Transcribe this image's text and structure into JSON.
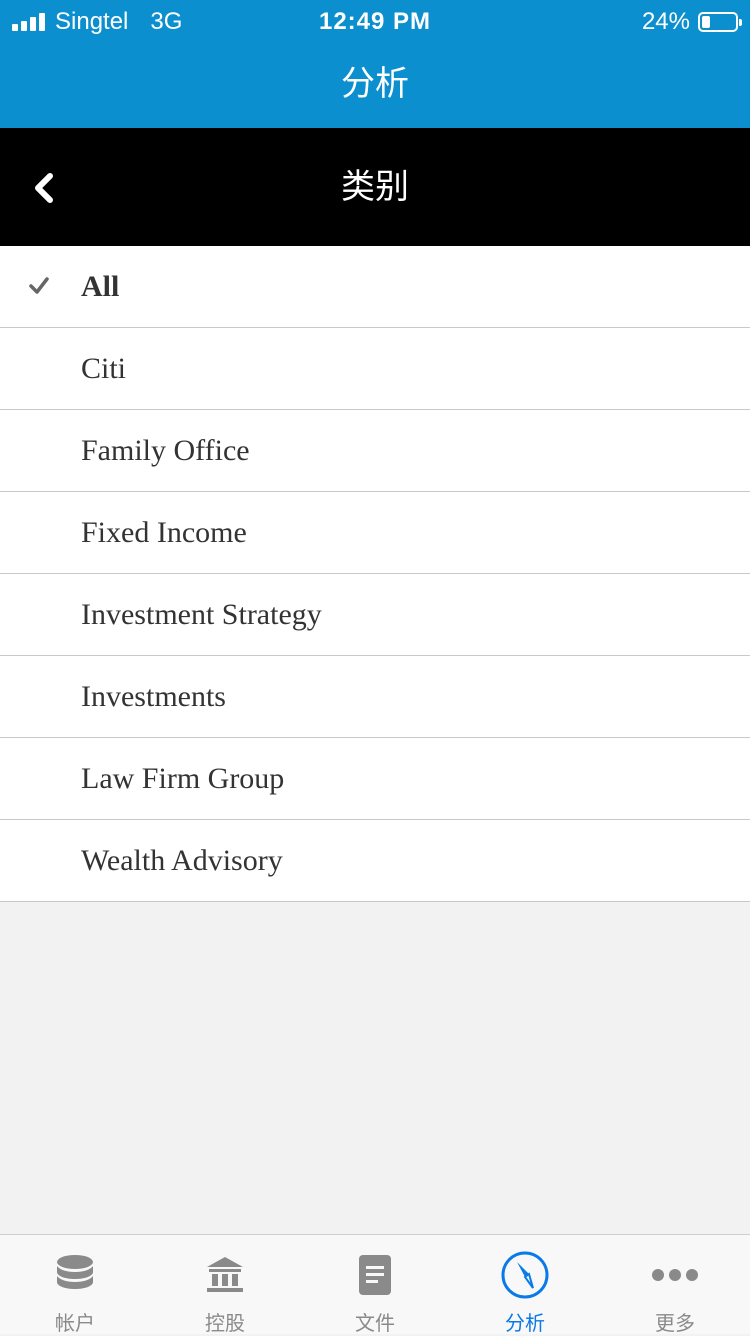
{
  "status_bar": {
    "carrier": "Singtel",
    "network": "3G",
    "time": "12:49 PM",
    "battery_percent": "24%",
    "battery_level": 0.24
  },
  "app_bar": {
    "title": "分析"
  },
  "sub_header": {
    "title": "类别",
    "back_icon": "chevron-left-icon"
  },
  "categories": [
    {
      "label": "All",
      "selected": true
    },
    {
      "label": "Citi",
      "selected": false
    },
    {
      "label": "Family Office",
      "selected": false
    },
    {
      "label": "Fixed Income",
      "selected": false
    },
    {
      "label": "Investment Strategy",
      "selected": false
    },
    {
      "label": "Investments",
      "selected": false
    },
    {
      "label": "Law Firm Group",
      "selected": false
    },
    {
      "label": "Wealth Advisory",
      "selected": false
    }
  ],
  "tab_bar": {
    "tabs": [
      {
        "label": "帐户",
        "icon": "database-icon",
        "active": false
      },
      {
        "label": "控股",
        "icon": "bank-icon",
        "active": false
      },
      {
        "label": "文件",
        "icon": "document-icon",
        "active": false
      },
      {
        "label": "分析",
        "icon": "compass-icon",
        "active": true
      },
      {
        "label": "更多",
        "icon": "more-icon",
        "active": false
      }
    ]
  },
  "colors": {
    "primary": "#0c8fce",
    "tab_active": "#0a7ae8",
    "tab_inactive": "#8a8a8a",
    "header_bg": "#000000"
  }
}
